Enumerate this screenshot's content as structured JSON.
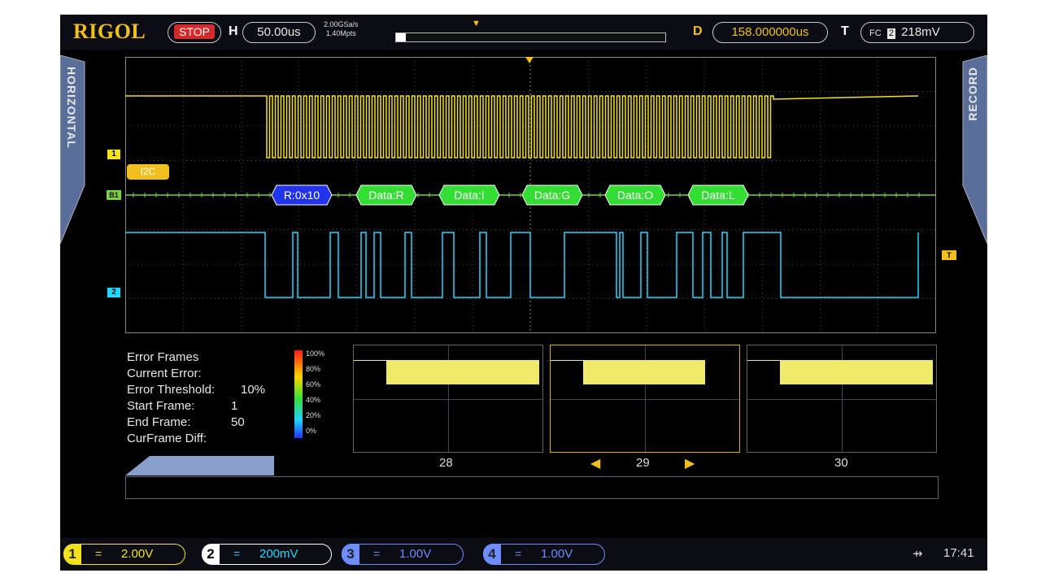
{
  "brand": "RIGOL",
  "run_state": "STOP",
  "horizontal": {
    "label": "H",
    "timebase": "50.00us"
  },
  "acquisition": {
    "sample_rate": "2.00GSa/s",
    "memory_depth": "1.40Mpts"
  },
  "delay": {
    "label": "D",
    "value": "158.000000us"
  },
  "trigger": {
    "label": "T",
    "value": "218mV"
  },
  "side_tabs": {
    "left": "HORIZONTAL",
    "right": "RECORD"
  },
  "decode": {
    "bus_label": "I2C",
    "packets": [
      {
        "text": "R:0x10",
        "kind": "address",
        "color": "#2233ee"
      },
      {
        "text": "Data:R",
        "kind": "data",
        "color": "#33dd33"
      },
      {
        "text": "Data:I",
        "kind": "data",
        "color": "#33dd33"
      },
      {
        "text": "Data:G",
        "kind": "data",
        "color": "#33dd33"
      },
      {
        "text": "Data:O",
        "kind": "data",
        "color": "#33dd33"
      },
      {
        "text": "Data:L",
        "kind": "data",
        "color": "#33dd33"
      }
    ]
  },
  "channel_markers": {
    "ch1": "1",
    "bus": "B1",
    "ch2": "2"
  },
  "error_panel": {
    "rows": [
      {
        "label": "Error Frames",
        "value": ""
      },
      {
        "label": "Current Error:",
        "value": ""
      },
      {
        "label": "Error Threshold:",
        "value": "10%"
      },
      {
        "label": "Start Frame:",
        "value": "1"
      },
      {
        "label": "End Frame:",
        "value": "50"
      },
      {
        "label": "CurFrame Diff:",
        "value": ""
      }
    ],
    "scale_labels": [
      "100%",
      "80%",
      "60%",
      "40%",
      "20%",
      "0%"
    ]
  },
  "frames": [
    {
      "number": "28",
      "selected": false
    },
    {
      "number": "29",
      "selected": true
    },
    {
      "number": "30",
      "selected": false
    }
  ],
  "channels": [
    {
      "num": "1",
      "coupling": "=",
      "scale": "2.00V",
      "color": "#f2e21e",
      "active": false
    },
    {
      "num": "2",
      "coupling": "=",
      "scale": "200mV",
      "color": "#20d8ff",
      "active": true
    },
    {
      "num": "3",
      "coupling": "=",
      "scale": "1.00V",
      "color": "#6c8cff",
      "active": false
    },
    {
      "num": "4",
      "coupling": "=",
      "scale": "1.00V",
      "color": "#6c8cff",
      "active": false
    }
  ],
  "clock": "17:41",
  "colors": {
    "ch1": "#f2e21e",
    "ch2": "#20d8ff",
    "accent": "#f2c01e"
  }
}
